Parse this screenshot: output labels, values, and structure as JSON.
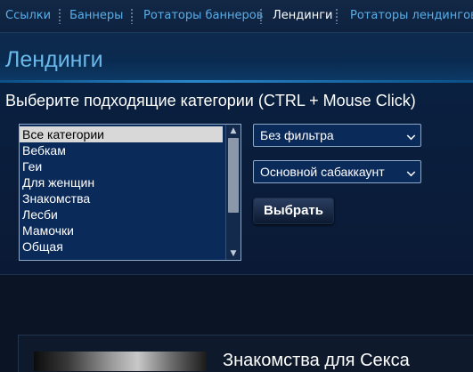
{
  "nav": {
    "items": [
      {
        "label": "Ссылки",
        "active": false
      },
      {
        "label": "Баннеры",
        "active": false
      },
      {
        "label": "Ротаторы баннеров",
        "active": false
      },
      {
        "label": "Лендинги",
        "active": true
      },
      {
        "label": "Ротаторы лендингов",
        "active": false
      }
    ]
  },
  "page": {
    "title": "Лендинги",
    "instruction": "Выберите подходящие категории (CTRL + Mouse Click)"
  },
  "categories": {
    "items": [
      "Все категории",
      "Вебкам",
      "Геи",
      "Для женщин",
      "Знакомства",
      "Лесби",
      "Мамочки",
      "Общая"
    ],
    "selected": "Все категории"
  },
  "filters": {
    "filter_select": "Без фильтра",
    "subaccount_select": "Основной сабаккаунт",
    "submit_label": "Выбрать"
  },
  "landing": {
    "title": "Знакомства для Секса"
  },
  "colors": {
    "background": "#0a1a33",
    "accent": "#5aaee8",
    "title": "#6ab8ea"
  },
  "icons": [
    "chevron-up-icon",
    "chevron-down-icon",
    "select-chevron-icon"
  ]
}
